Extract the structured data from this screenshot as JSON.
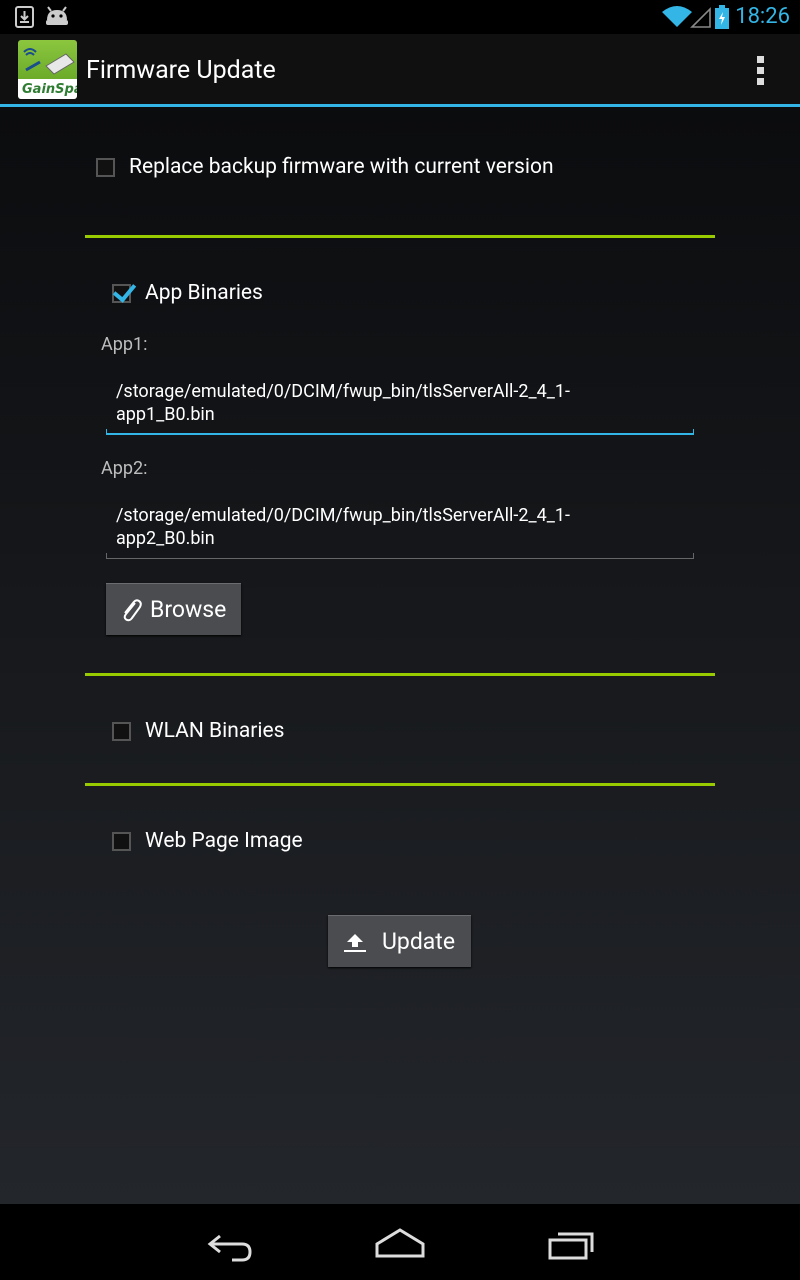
{
  "status_bar": {
    "time": "18:26"
  },
  "action_bar": {
    "title": "Firmware Update",
    "logo_text": "GainSpan"
  },
  "backup_option": {
    "label": "Replace backup firmware with current version",
    "checked": false
  },
  "app_binaries": {
    "label": "App Binaries",
    "checked": true,
    "app1": {
      "label": "App1:",
      "value_line1": "/storage/emulated/0/DCIM/fwup_bin/tlsServerAll-2_4_1-",
      "value_line2": "app1_B0.bin"
    },
    "app2": {
      "label": "App2:",
      "value_line1": "/storage/emulated/0/DCIM/fwup_bin/tlsServerAll-2_4_1-",
      "value_line2": "app2_B0.bin"
    },
    "browse_label": "Browse"
  },
  "wlan_binaries": {
    "label": "WLAN Binaries",
    "checked": false
  },
  "web_page_image": {
    "label": "Web Page Image",
    "checked": false
  },
  "update_label": "Update",
  "colors": {
    "accent": "#33b5e5",
    "separator": "#99cc00"
  }
}
